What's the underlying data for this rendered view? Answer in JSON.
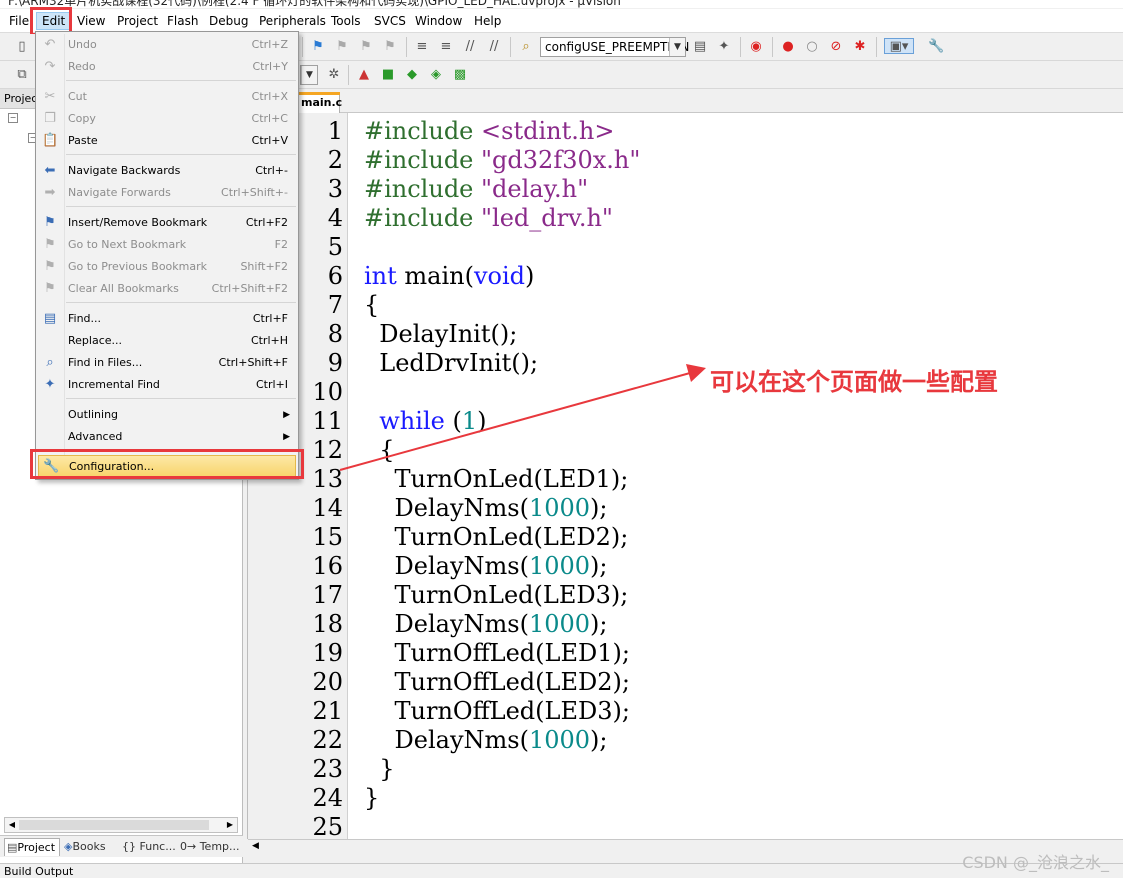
{
  "window": {
    "title": "F:\\ARM32单片机实战课程(32代码)\\例程(2.4 F 循环灯的软件架构和代码实现)\\GPIO_LED_HAL.uvprojx - µVision"
  },
  "menubar": [
    {
      "label": "File"
    },
    {
      "label": "Edit"
    },
    {
      "label": "View"
    },
    {
      "label": "Project"
    },
    {
      "label": "Flash"
    },
    {
      "label": "Debug"
    },
    {
      "label": "Peripherals"
    },
    {
      "label": "Tools"
    },
    {
      "label": "SVCS"
    },
    {
      "label": "Window"
    },
    {
      "label": "Help"
    }
  ],
  "toolbar": {
    "config_combo": "configUSE_PREEMPTION"
  },
  "edit_menu": {
    "items": [
      {
        "label": "Undo",
        "shortcut": "Ctrl+Z",
        "disabled": true,
        "icon": "undo-icon"
      },
      {
        "label": "Redo",
        "shortcut": "Ctrl+Y",
        "disabled": true,
        "icon": "redo-icon"
      },
      {
        "label": "Cut",
        "shortcut": "Ctrl+X",
        "disabled": true,
        "icon": "scissors-icon"
      },
      {
        "label": "Copy",
        "shortcut": "Ctrl+C",
        "disabled": true,
        "icon": "copy-icon"
      },
      {
        "label": "Paste",
        "shortcut": "Ctrl+V",
        "disabled": false,
        "icon": "paste-icon"
      },
      {
        "label": "Navigate Backwards",
        "shortcut": "Ctrl+-",
        "disabled": false,
        "icon": "arrow-left-icon"
      },
      {
        "label": "Navigate Forwards",
        "shortcut": "Ctrl+Shift+-",
        "disabled": true,
        "icon": "arrow-right-icon"
      },
      {
        "label": "Insert/Remove Bookmark",
        "shortcut": "Ctrl+F2",
        "disabled": false,
        "icon": "bookmark-icon"
      },
      {
        "label": "Go to Next Bookmark",
        "shortcut": "F2",
        "disabled": true,
        "icon": "next-bookmark-icon"
      },
      {
        "label": "Go to Previous Bookmark",
        "shortcut": "Shift+F2",
        "disabled": true,
        "icon": "prev-bookmark-icon"
      },
      {
        "label": "Clear All Bookmarks",
        "shortcut": "Ctrl+Shift+F2",
        "disabled": true,
        "icon": "clear-bookmarks-icon"
      },
      {
        "label": "Find...",
        "shortcut": "Ctrl+F",
        "disabled": false,
        "icon": "find-icon"
      },
      {
        "label": "Replace...",
        "shortcut": "Ctrl+H",
        "disabled": false,
        "icon": ""
      },
      {
        "label": "Find in Files...",
        "shortcut": "Ctrl+Shift+F",
        "disabled": false,
        "icon": "find-in-files-icon"
      },
      {
        "label": "Incremental Find",
        "shortcut": "Ctrl+I",
        "disabled": false,
        "icon": "binoculars-icon"
      },
      {
        "label": "Outlining",
        "shortcut": "",
        "disabled": false,
        "icon": "",
        "submenu": true
      },
      {
        "label": "Advanced",
        "shortcut": "",
        "disabled": false,
        "icon": "",
        "submenu": true
      },
      {
        "label": "Configuration...",
        "shortcut": "",
        "disabled": false,
        "icon": "wrench-icon",
        "highlighted": true
      }
    ]
  },
  "project_panel": {
    "header": "Project",
    "bottom_tabs": [
      {
        "label": "Project"
      },
      {
        "label": "Books"
      },
      {
        "label": "{} Func..."
      },
      {
        "label": "0→ Temp..."
      }
    ]
  },
  "editor": {
    "active_tab": "main.c",
    "lines": [
      {
        "n": "1",
        "tokens": [
          {
            "t": "#include ",
            "c": "kw-inc"
          },
          {
            "t": "<stdint.h>",
            "c": "str"
          }
        ]
      },
      {
        "n": "2",
        "tokens": [
          {
            "t": "#include ",
            "c": "kw-inc"
          },
          {
            "t": "\"gd32f30x.h\"",
            "c": "str"
          }
        ]
      },
      {
        "n": "3",
        "tokens": [
          {
            "t": "#include ",
            "c": "kw-inc"
          },
          {
            "t": "\"delay.h\"",
            "c": "str"
          }
        ]
      },
      {
        "n": "4",
        "tokens": [
          {
            "t": "#include ",
            "c": "kw-inc"
          },
          {
            "t": "\"led_drv.h\"",
            "c": "str"
          }
        ]
      },
      {
        "n": "5",
        "tokens": []
      },
      {
        "n": "6",
        "tokens": [
          {
            "t": "int",
            "c": "kw-blue"
          },
          {
            "t": " main(",
            "c": ""
          },
          {
            "t": "void",
            "c": "kw-blue"
          },
          {
            "t": ")",
            "c": ""
          }
        ]
      },
      {
        "n": "7",
        "tokens": [
          {
            "t": "{",
            "c": ""
          }
        ],
        "fold": true
      },
      {
        "n": "8",
        "tokens": [
          {
            "t": "  DelayInit();",
            "c": ""
          }
        ]
      },
      {
        "n": "9",
        "tokens": [
          {
            "t": "  LedDrvInit();",
            "c": ""
          }
        ]
      },
      {
        "n": "10",
        "tokens": []
      },
      {
        "n": "11",
        "tokens": [
          {
            "t": "  ",
            "c": ""
          },
          {
            "t": "while",
            "c": "kw-blue"
          },
          {
            "t": " (",
            "c": ""
          },
          {
            "t": "1",
            "c": "num"
          },
          {
            "t": ")",
            "c": ""
          }
        ]
      },
      {
        "n": "12",
        "tokens": [
          {
            "t": "  {",
            "c": ""
          }
        ],
        "fold": true
      },
      {
        "n": "13",
        "tokens": [
          {
            "t": "    TurnOnLed(LED1);",
            "c": ""
          }
        ]
      },
      {
        "n": "14",
        "tokens": [
          {
            "t": "    DelayNms(",
            "c": ""
          },
          {
            "t": "1000",
            "c": "num"
          },
          {
            "t": ");",
            "c": ""
          }
        ]
      },
      {
        "n": "15",
        "tokens": [
          {
            "t": "    TurnOnLed(LED2);",
            "c": ""
          }
        ]
      },
      {
        "n": "16",
        "tokens": [
          {
            "t": "    DelayNms(",
            "c": ""
          },
          {
            "t": "1000",
            "c": "num"
          },
          {
            "t": ");",
            "c": ""
          }
        ]
      },
      {
        "n": "17",
        "tokens": [
          {
            "t": "    TurnOnLed(LED3);",
            "c": ""
          }
        ]
      },
      {
        "n": "18",
        "tokens": [
          {
            "t": "    DelayNms(",
            "c": ""
          },
          {
            "t": "1000",
            "c": "num"
          },
          {
            "t": ");",
            "c": ""
          }
        ]
      },
      {
        "n": "19",
        "tokens": [
          {
            "t": "    TurnOffLed(LED1);",
            "c": ""
          }
        ]
      },
      {
        "n": "20",
        "tokens": [
          {
            "t": "    TurnOffLed(LED2);",
            "c": ""
          }
        ]
      },
      {
        "n": "21",
        "tokens": [
          {
            "t": "    TurnOffLed(LED3);",
            "c": ""
          }
        ]
      },
      {
        "n": "22",
        "tokens": [
          {
            "t": "    DelayNms(",
            "c": ""
          },
          {
            "t": "1000",
            "c": "num"
          },
          {
            "t": ");",
            "c": ""
          }
        ]
      },
      {
        "n": "23",
        "tokens": [
          {
            "t": "  }",
            "c": ""
          }
        ]
      },
      {
        "n": "24",
        "tokens": [
          {
            "t": "}",
            "c": ""
          }
        ]
      },
      {
        "n": "25",
        "tokens": []
      }
    ]
  },
  "status": {
    "build_output": "Build Output"
  },
  "annotation": {
    "text": "可以在这个页面做一些配置",
    "color": "#e8383d"
  },
  "watermark": "CSDN @_沧浪之水_"
}
